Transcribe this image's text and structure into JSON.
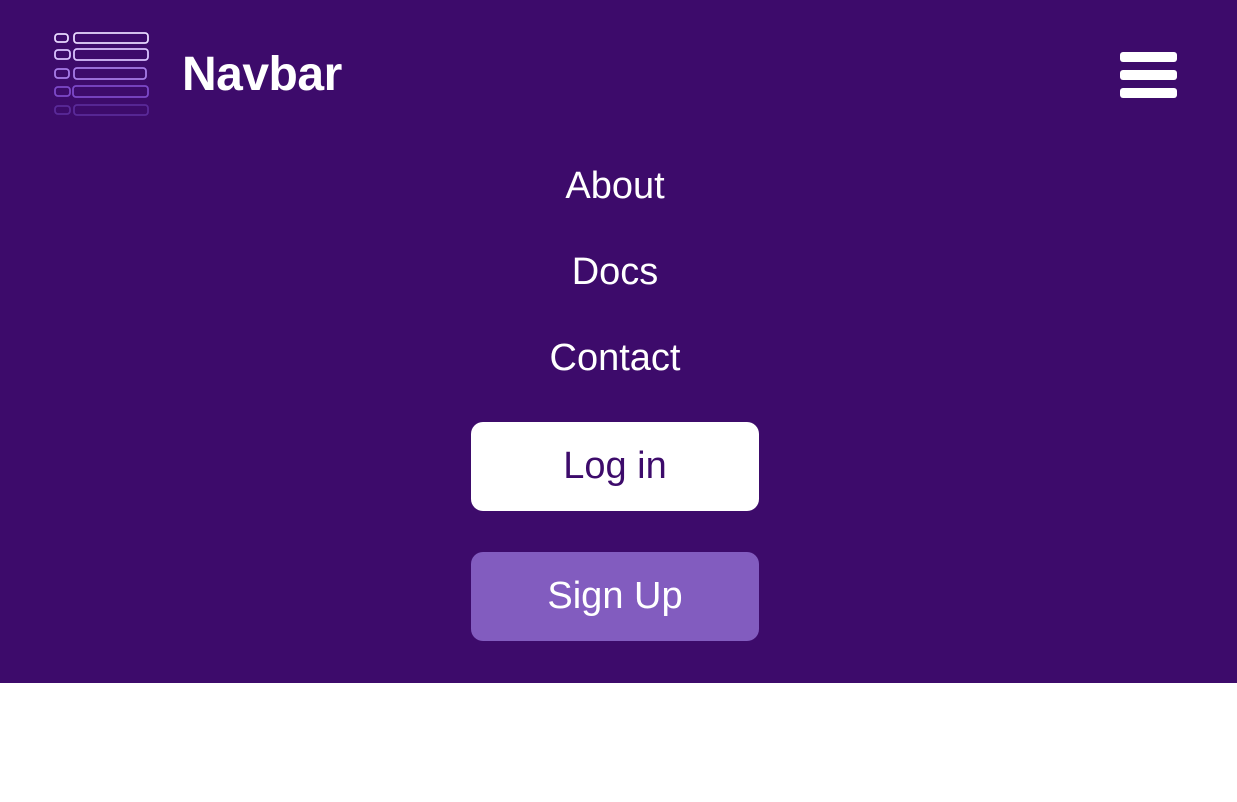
{
  "brand": {
    "title": "Navbar",
    "logo_icon": "stacked-list-logo-icon"
  },
  "menu_toggle": {
    "icon": "hamburger-menu-icon"
  },
  "nav": {
    "links": [
      {
        "label": "About"
      },
      {
        "label": "Docs"
      },
      {
        "label": "Contact"
      }
    ]
  },
  "actions": {
    "login_label": "Log in",
    "signup_label": "Sign Up"
  },
  "colors": {
    "navbar_background": "#3d0b6b",
    "signup_background": "#825cbf",
    "login_background": "#ffffff",
    "login_text": "#3d0b6b",
    "text": "#ffffff"
  }
}
